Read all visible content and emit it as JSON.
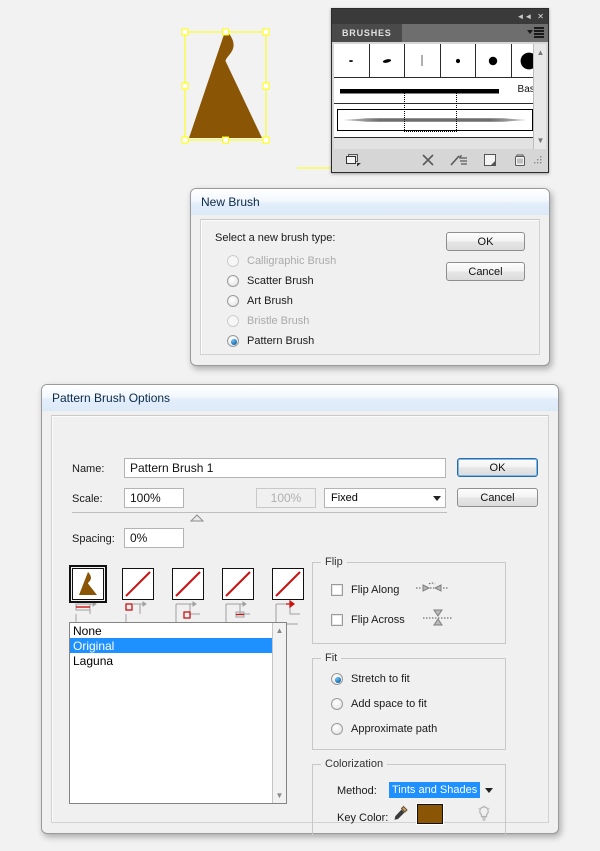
{
  "app": {
    "accent_blue": "#1e90ff",
    "key_color_hex": "#8a5606",
    "artwork_fill": "#8a5606",
    "selection_path_color": "#ffff00"
  },
  "brushes_panel": {
    "tab_label": "BRUSHES",
    "collapse_icon": "collapse-double-arrow-icon",
    "close_icon": "close-icon",
    "menu_icon": "panel-menu-icon",
    "section_label": "Basic",
    "thumbnails": [
      "tiny-dot-brush",
      "small-blob-brush",
      "thin-line-brush",
      "small-dot-brush",
      "medium-dot-brush",
      "large-dot-brush"
    ],
    "footer_buttons": [
      {
        "name": "brush-libraries-menu-icon"
      },
      {
        "name": "remove-brush-stroke-icon"
      },
      {
        "name": "options-of-selected-object-icon"
      },
      {
        "name": "new-brush-icon"
      },
      {
        "name": "delete-brush-icon"
      }
    ]
  },
  "new_brush_dialog": {
    "title": "New Brush",
    "prompt": "Select a new brush type:",
    "options": [
      {
        "label": "Calligraphic Brush",
        "selected": false,
        "enabled": false
      },
      {
        "label": "Scatter Brush",
        "selected": false,
        "enabled": true
      },
      {
        "label": "Art Brush",
        "selected": false,
        "enabled": true
      },
      {
        "label": "Bristle Brush",
        "selected": false,
        "enabled": false
      },
      {
        "label": "Pattern Brush",
        "selected": true,
        "enabled": true
      }
    ],
    "ok_label": "OK",
    "cancel_label": "Cancel"
  },
  "pattern_brush_dialog": {
    "title": "Pattern Brush Options",
    "name_label": "Name:",
    "name_value": "Pattern Brush 1",
    "scale_label": "Scale:",
    "scale_value": "100%",
    "scale_secondary_value": "100%",
    "scale_mode": "Fixed",
    "spacing_label": "Spacing:",
    "spacing_value": "0%",
    "ok_label": "OK",
    "cancel_label": "Cancel",
    "tiles": [
      {
        "name": "side-tile",
        "selected": true,
        "has_art": true
      },
      {
        "name": "outer-corner-tile",
        "selected": false,
        "has_art": false
      },
      {
        "name": "inner-corner-tile",
        "selected": false,
        "has_art": false
      },
      {
        "name": "start-tile",
        "selected": false,
        "has_art": false
      },
      {
        "name": "end-tile",
        "selected": false,
        "has_art": false
      }
    ],
    "pattern_list": [
      {
        "label": "None",
        "selected": false
      },
      {
        "label": "Original",
        "selected": true
      },
      {
        "label": "Laguna",
        "selected": false
      }
    ],
    "flip": {
      "title": "Flip",
      "items": [
        {
          "label": "Flip Along",
          "checked": false,
          "icon": "flip-along-icon"
        },
        {
          "label": "Flip Across",
          "checked": false,
          "icon": "flip-across-icon"
        }
      ]
    },
    "fit": {
      "title": "Fit",
      "items": [
        {
          "label": "Stretch to fit",
          "selected": true
        },
        {
          "label": "Add space to fit",
          "selected": false
        },
        {
          "label": "Approximate path",
          "selected": false
        }
      ]
    },
    "colorization": {
      "title": "Colorization",
      "method_label": "Method:",
      "method_value": "Tints and Shades",
      "key_color_label": "Key Color:",
      "eyedropper_icon": "eyedropper-icon",
      "key_color_swatch": "#8a5606",
      "tip_icon": "lightbulb-tip-icon"
    }
  }
}
